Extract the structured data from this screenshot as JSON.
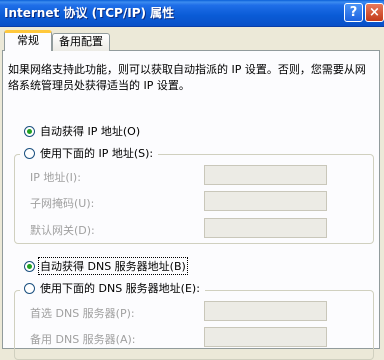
{
  "window": {
    "title": "Internet 协议 (TCP/IP) 属性",
    "help_label": "?",
    "close_label": "×"
  },
  "tabs": [
    {
      "label": "常规",
      "active": true
    },
    {
      "label": "备用配置",
      "active": false
    }
  ],
  "description": "如果网络支持此功能，则可以获取自动指派的 IP 设置。否则，您需要从网络系统管理员处获得适当的 IP 设置。",
  "ip_options": {
    "auto": {
      "label": "自动获得 IP 地址(O)",
      "checked": true
    },
    "manual": {
      "label": "使用下面的 IP 地址(S):",
      "checked": false
    }
  },
  "ip_fields": [
    {
      "label": "IP 地址(I):",
      "value": ""
    },
    {
      "label": "子网掩码(U):",
      "value": ""
    },
    {
      "label": "默认网关(D):",
      "value": ""
    }
  ],
  "dns_options": {
    "auto": {
      "label": "自动获得 DNS 服务器地址(B)",
      "checked": true
    },
    "manual": {
      "label": "使用下面的 DNS 服务器地址(E):",
      "checked": false
    }
  },
  "dns_fields": [
    {
      "label": "首选 DNS 服务器(P):",
      "value": ""
    },
    {
      "label": "备用 DNS 服务器(A):",
      "value": ""
    }
  ],
  "colors": {
    "titlebar": "#0a5bd6",
    "tab_highlight": "#ffc83c",
    "radio_dot": "#21a121",
    "disabled_text": "#a0a0a0"
  }
}
